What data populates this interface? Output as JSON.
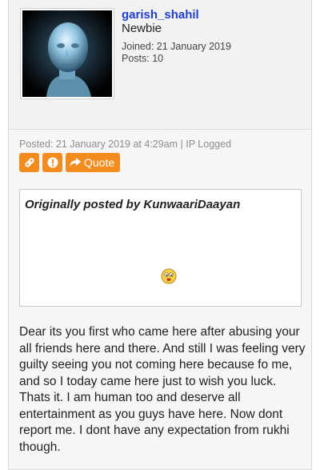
{
  "author": {
    "username": "garish_shahil",
    "rank": "Newbie",
    "joined": "Joined: 21 January 2019",
    "posts": "Posts: 10"
  },
  "post": {
    "meta": "Posted: 21 January 2019 at 4:29am | IP Logged",
    "buttons": {
      "link_icon": "link-icon",
      "report_icon": "exclamation-icon",
      "quote_label": "Quote",
      "quote_icon": "share-arrow-icon"
    },
    "accent_color": "#f28c1e",
    "quote": {
      "header": "Originally posted by KunwaariDaayan",
      "emoji": "worried-face-emoji"
    },
    "message": "Dear its you first who came here after abusing your all friends here and there. And still I was feeling very guilty seeing you not coming here because fo me, and so I today came here just to wish you luck. Thats it. I am human too and deserve all entertainment as you guys have here. Now dont report me. I dont have any expectation from rukhi though."
  }
}
